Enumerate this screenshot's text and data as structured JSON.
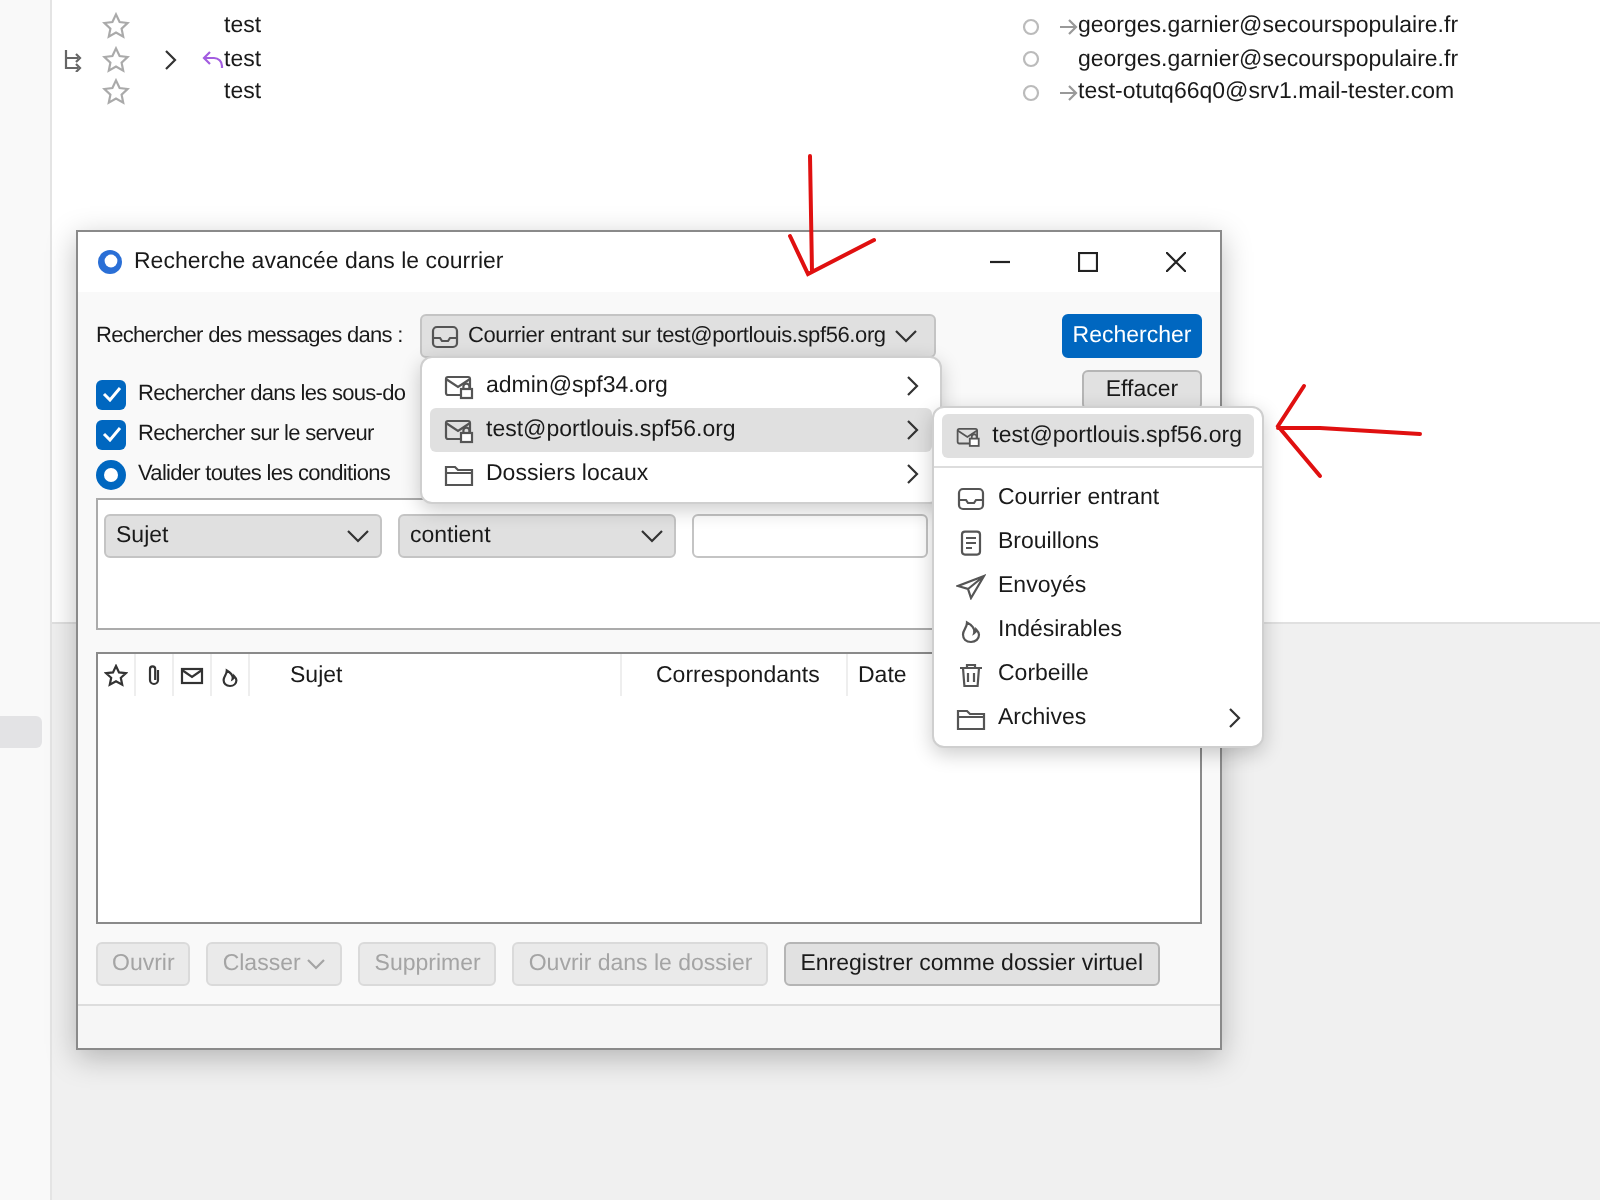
{
  "messages": [
    {
      "subject": "test",
      "thread": false,
      "replied": false,
      "outgoing": true,
      "correspondent": "georges.garnier@secourspopulaire.fr"
    },
    {
      "subject": "test",
      "thread": true,
      "replied": true,
      "outgoing": false,
      "correspondent": "georges.garnier@secourspopulaire.fr"
    },
    {
      "subject": "test",
      "thread": false,
      "replied": false,
      "outgoing": true,
      "correspondent": "test-otutq66q0@srv1.mail-tester.com"
    }
  ],
  "dialog": {
    "title": "Recherche avancée dans le courrier",
    "search_in_label": "Rechercher des messages dans :",
    "folder": "Courrier entrant sur test@portlouis.spf56.org",
    "search_button": "Rechercher",
    "clear_button": "Effacer",
    "options": [
      {
        "label": "Rechercher dans les sous-do",
        "checked": true
      },
      {
        "label": "Rechercher sur le serveur",
        "checked": true
      }
    ],
    "match": {
      "label": "Valider toutes les conditions",
      "selected": true
    },
    "condition": {
      "field": "Sujet",
      "operator": "contient"
    },
    "columns": [
      "Sujet",
      "Correspondants",
      "Date"
    ],
    "buttons": [
      {
        "label": "Ouvrir",
        "kind": "plain",
        "disabled": true
      },
      {
        "label": "Classer",
        "kind": "menu",
        "disabled": true
      },
      {
        "label": "Supprimer",
        "kind": "plain",
        "disabled": true
      },
      {
        "label": "Ouvrir dans le dossier",
        "kind": "plain",
        "disabled": true
      },
      {
        "label": "Enregistrer comme dossier virtuel",
        "kind": "plain",
        "disabled": false
      }
    ]
  },
  "account_menu": [
    {
      "label": "admin@spf34.org",
      "kind": "account",
      "selected": false
    },
    {
      "label": "test@portlouis.spf56.org",
      "kind": "account",
      "selected": true
    },
    {
      "label": "Dossiers locaux",
      "kind": "local",
      "selected": false
    }
  ],
  "folder_menu": [
    {
      "label": "test@portlouis.spf56.org",
      "kind": "account",
      "selected": true,
      "submenu": false
    },
    {
      "label": "Courrier entrant",
      "kind": "inbox",
      "selected": false,
      "submenu": false
    },
    {
      "label": "Brouillons",
      "kind": "drafts",
      "selected": false,
      "submenu": false
    },
    {
      "label": "Envoyés",
      "kind": "sent",
      "selected": false,
      "submenu": false
    },
    {
      "label": "Indésirables",
      "kind": "junk",
      "selected": false,
      "submenu": false
    },
    {
      "label": "Corbeille",
      "kind": "trash",
      "selected": false,
      "submenu": false
    },
    {
      "label": "Archives",
      "kind": "folder",
      "selected": false,
      "submenu": true
    }
  ]
}
